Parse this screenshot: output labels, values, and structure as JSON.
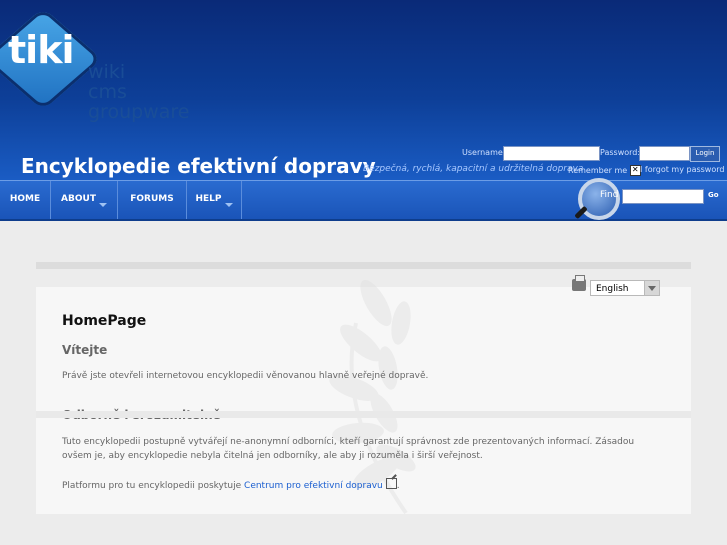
{
  "header": {
    "logo_text": "tiki",
    "logo_sub": [
      "wiki",
      "cms",
      "groupware"
    ],
    "site_title": "Encyklopedie efektivní dopravy",
    "site_slogan": "Bezpečná, rychlá, kapacitní a udržitelná doprava",
    "colors": {
      "header_bg": "#0d3f98",
      "nav_bg": "#1a54b8",
      "link": "#1b5fd0"
    }
  },
  "login": {
    "username_label": "Username:",
    "password_label": "Password:",
    "login_button": "Login",
    "remember_label": "Remember me",
    "forgot_label": "I forgot my password"
  },
  "nav": {
    "items": [
      {
        "label": "HOME",
        "has_dropdown": false
      },
      {
        "label": "ABOUT",
        "has_dropdown": true
      },
      {
        "label": "FORUMS",
        "has_dropdown": false
      },
      {
        "label": "HELP",
        "has_dropdown": true
      }
    ]
  },
  "search": {
    "find_label": "Find",
    "go_button": "Go"
  },
  "page": {
    "language": "English",
    "title": "HomePage",
    "sections": [
      {
        "heading": "Vítejte",
        "paragraphs": [
          "Právě jste otevřeli internetovou encyklopedii věnovanou hlavně veřejné dopravě."
        ]
      },
      {
        "heading": "Odborně i srozumitelně",
        "paragraphs": [
          "Tuto encyklopedii postupně vytvářejí ne-anonymní odborníci, kteří garantují správnost zde prezentovaných informací. Zásadou ovšem je, aby encyklopedie nebyla čitelná jen odborníky, ale aby ji rozuměla i širší veřejnost.",
          "Platformu pro tu encyklopedii poskytuje"
        ],
        "link_text": "Centrum pro efektivní dopravu",
        "after_link": "."
      }
    ]
  }
}
